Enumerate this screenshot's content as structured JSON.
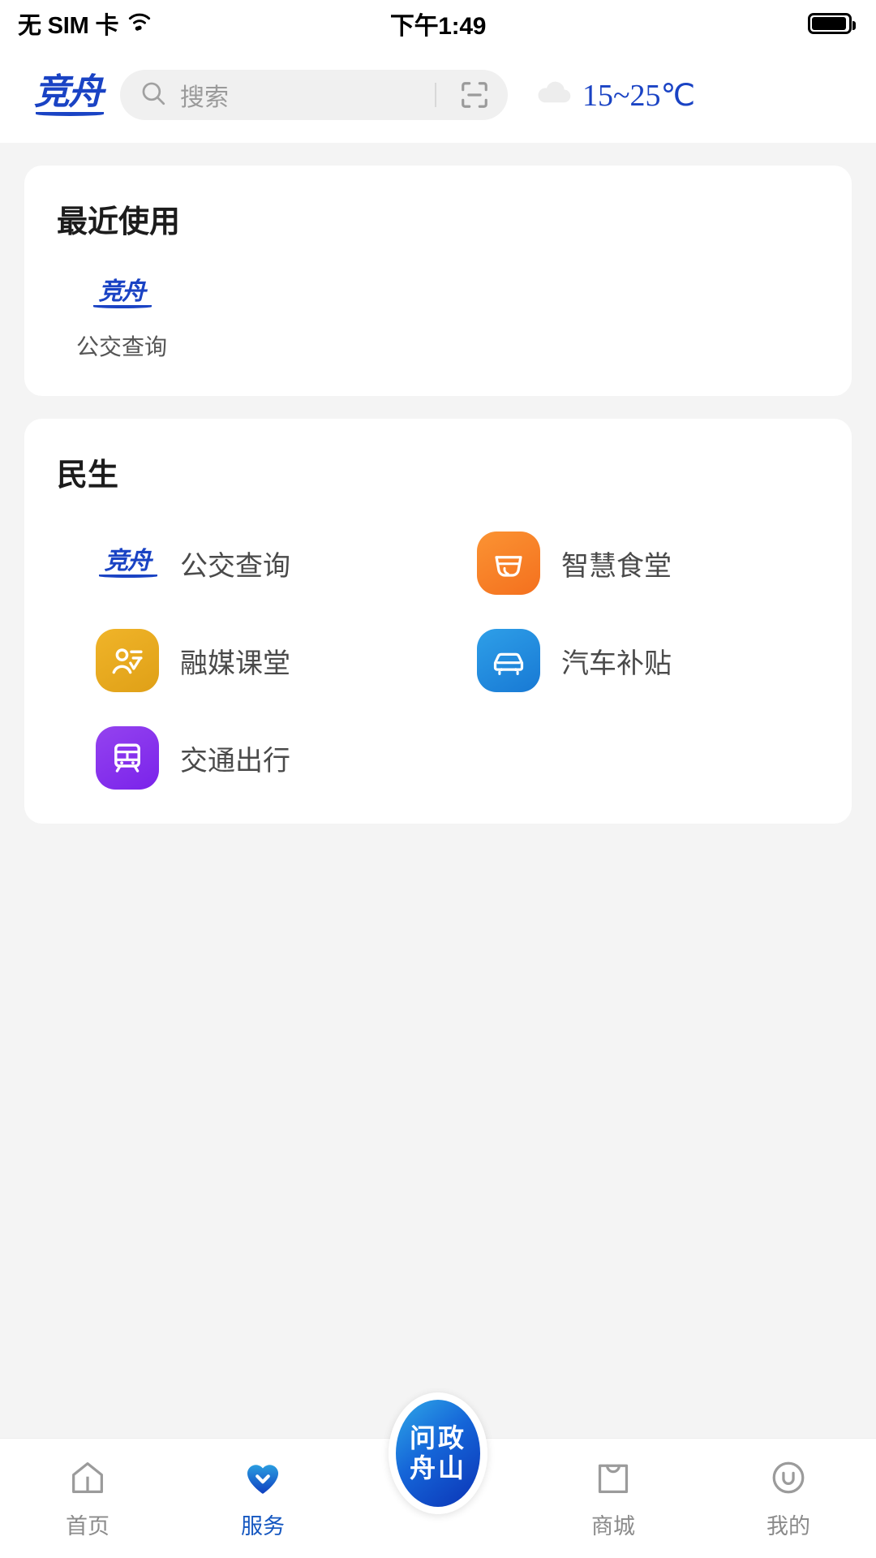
{
  "status_bar": {
    "carrier": "无 SIM 卡",
    "wifi_icon": "wifi-icon",
    "time": "下午1:49",
    "battery_icon": "battery-icon"
  },
  "header": {
    "logo_text": "竞舟",
    "logo_name": "jingzhou-logo",
    "search": {
      "icon": "search-icon",
      "placeholder": "搜索",
      "scan_icon": "scan-icon"
    },
    "weather": {
      "icon": "cloud-icon",
      "temperature": "15~25℃",
      "accent_color": "#1a43c4"
    }
  },
  "recent_card": {
    "title": "最近使用",
    "items": [
      {
        "label": "公交查询",
        "icon": "jingzhou-bus-logo-icon",
        "logo_text": "竞舟"
      }
    ]
  },
  "services_card": {
    "title": "民生",
    "items": [
      {
        "label": "公交查询",
        "icon": "jingzhou-bus-logo-icon",
        "logo_text": "竞舟",
        "color": "#1a43c4"
      },
      {
        "label": "智慧食堂",
        "icon": "bowl-icon",
        "color": "#f4701e"
      },
      {
        "label": "融媒课堂",
        "icon": "person-check-icon",
        "color": "#dfa017"
      },
      {
        "label": "汽车补贴",
        "icon": "car-icon",
        "color": "#1879d4"
      },
      {
        "label": "交通出行",
        "icon": "train-icon",
        "color": "#7a23ea"
      }
    ]
  },
  "tabbar": {
    "active_color": "#1557c0",
    "inactive_color": "#8b8b8b",
    "tabs": [
      {
        "label": "首页",
        "icon": "home-icon",
        "active": false
      },
      {
        "label": "服务",
        "icon": "heart-check-icon",
        "active": true
      },
      {
        "label": "商城",
        "icon": "shopping-bag-icon",
        "active": false
      },
      {
        "label": "我的",
        "icon": "profile-icon",
        "active": false
      }
    ],
    "fab": {
      "name": "wenzheng-zhoushan-button",
      "line1": "问政",
      "line2": "舟山"
    }
  }
}
